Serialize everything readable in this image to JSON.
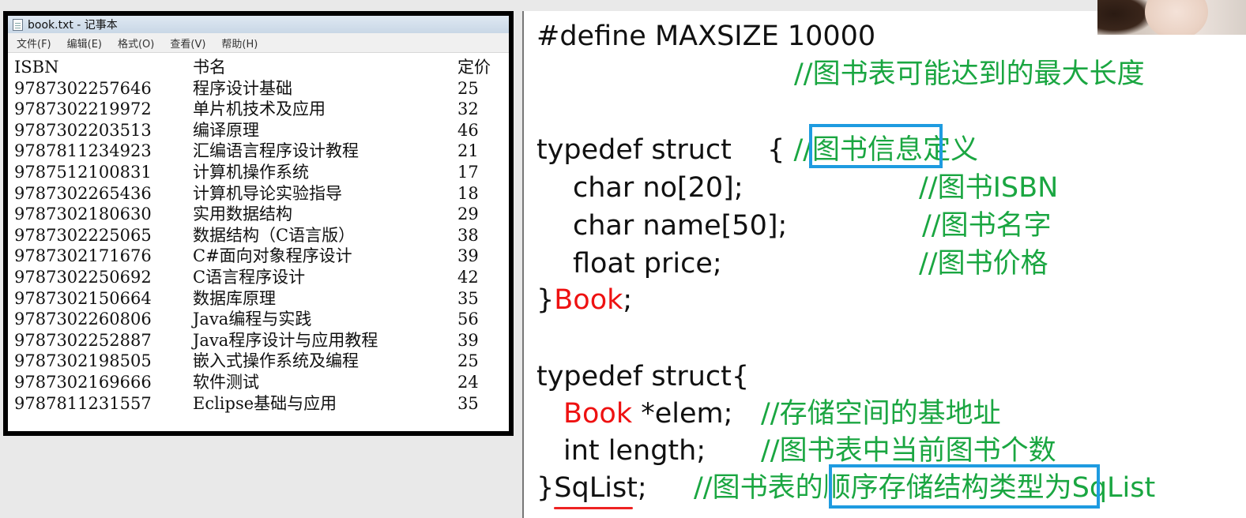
{
  "notepad": {
    "title": "book.txt - 记事本",
    "menu": [
      "文件(F)",
      "编辑(E)",
      "格式(O)",
      "查看(V)",
      "帮助(H)"
    ],
    "columns": [
      "ISBN",
      "书名",
      "定价"
    ],
    "rows": [
      [
        "9787302257646",
        "程序设计基础",
        "25"
      ],
      [
        "9787302219972",
        "单片机技术及应用",
        "32"
      ],
      [
        "9787302203513",
        "编译原理",
        "46"
      ],
      [
        "9787811234923",
        "汇编语言程序设计教程",
        "21"
      ],
      [
        "9787512100831",
        "计算机操作系统",
        "17"
      ],
      [
        "9787302265436",
        "计算机导论实验指导",
        "18"
      ],
      [
        "9787302180630",
        "实用数据结构",
        "29"
      ],
      [
        "9787302225065",
        "数据结构（C语言版）",
        "38"
      ],
      [
        "9787302171676",
        "C#面向对象程序设计",
        "39"
      ],
      [
        "9787302250692",
        "C语言程序设计",
        "42"
      ],
      [
        "9787302150664",
        "数据库原理",
        "35"
      ],
      [
        "9787302260806",
        "Java编程与实践",
        "56"
      ],
      [
        "9787302252887",
        "Java程序设计与应用教程",
        "39"
      ],
      [
        "9787302198505",
        "嵌入式操作系统及编程",
        "25"
      ],
      [
        "9787302169666",
        "软件测试",
        "24"
      ],
      [
        "9787811231557",
        "Eclipse基础与应用",
        "35"
      ]
    ]
  },
  "slide": {
    "define_code": "#define MAXSIZE 10000",
    "define_comment": "//图书表可能达到的最大长度",
    "book_open": "typedef struct",
    "book_brace": "{",
    "book_comment_slashes": "//",
    "book_comment_highlight": "图书信息",
    "book_comment_rest": "定义",
    "field_no": "char no[20];",
    "field_no_comment": "//图书ISBN",
    "field_name": "char name[50];",
    "field_name_comment": "//图书名字",
    "field_price": "float price;",
    "field_price_comment": "//图书价格",
    "book_close_brace": "}",
    "book_type": "Book",
    "semicolon": ";",
    "sqlist_open": "typedef struct{",
    "elem_type": "Book",
    "elem_rest": "*elem;",
    "elem_comment": "//存储空间的基地址",
    "length_field": "int length;",
    "length_comment": "//图书表中当前图书个数",
    "sqlist_close_brace": "}",
    "sqlist_name": "SqList",
    "sqlist_semicolon": ";",
    "sqlist_comment_a": "//图书表的",
    "sqlist_comment_highlight": "顺序存储结构类型",
    "sqlist_comment_b": "为SqList"
  },
  "colors": {
    "comment": "#1aa641",
    "keyword_red": "#e11111",
    "highlight_box": "#1e9be0"
  }
}
